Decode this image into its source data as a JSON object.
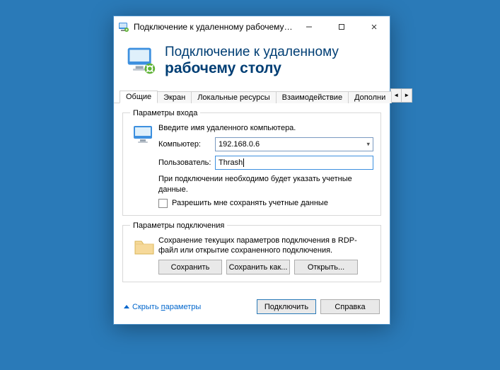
{
  "titlebar": {
    "text": "Подключение к удаленному рабочему с..."
  },
  "header": {
    "line1": "Подключение к удаленному",
    "line2": "рабочему столу"
  },
  "tabs": {
    "items": [
      {
        "label": "Общие"
      },
      {
        "label": "Экран"
      },
      {
        "label": "Локальные ресурсы"
      },
      {
        "label": "Взаимодействие"
      },
      {
        "label": "Дополни"
      }
    ]
  },
  "login_group": {
    "legend": "Параметры входа",
    "intro": "Введите имя удаленного компьютера.",
    "computer_label": "Компьютер:",
    "computer_value": "192.168.0.6",
    "user_label": "Пользователь:",
    "user_value": "Thrash",
    "note": "При подключении необходимо будет указать учетные данные.",
    "remember_label": "Разрешить мне сохранять учетные данные"
  },
  "conn_group": {
    "legend": "Параметры подключения",
    "desc": "Сохранение текущих параметров подключения в RDP-файл или открытие сохраненного подключения.",
    "save": "Сохранить",
    "save_as": "Сохранить как...",
    "open": "Открыть..."
  },
  "footer": {
    "hide_prefix": "Скрыть ",
    "hide_underlined": "п",
    "hide_suffix": "араметры",
    "connect": "Подключить",
    "help": "Справка"
  }
}
